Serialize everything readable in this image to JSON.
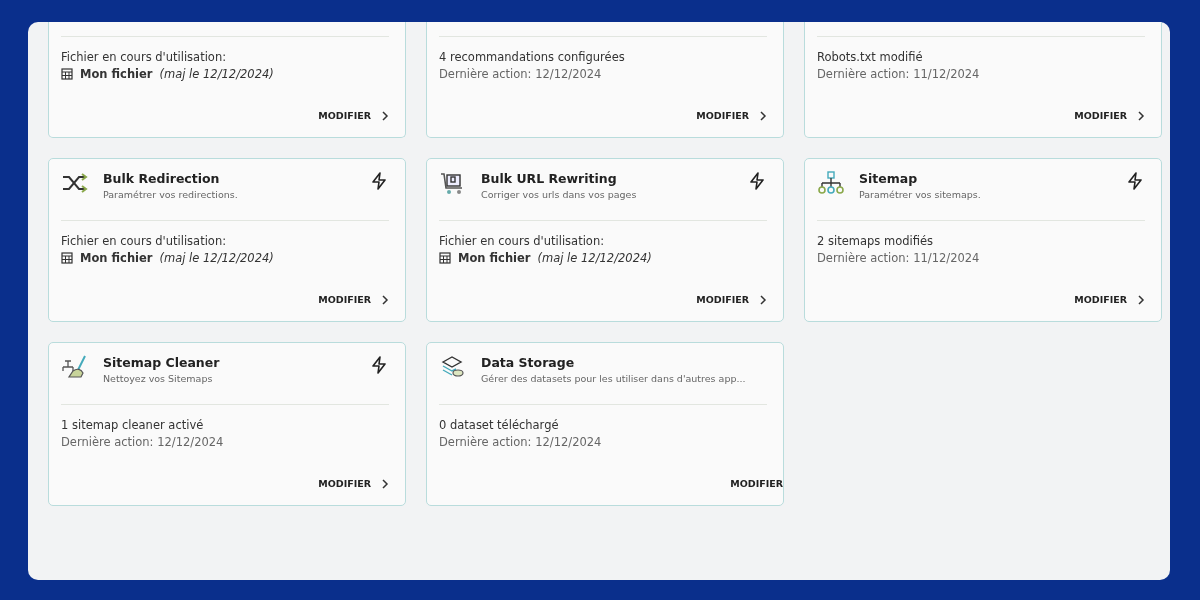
{
  "cards": [
    {
      "kind": "file",
      "label": "Fichier en cours d'utilisation:",
      "file_name": "Mon fichier",
      "file_date": "(maj le 12/12/2024)",
      "action": "MODIFIER",
      "chevron": true
    },
    {
      "kind": "stats",
      "line_1": "4 recommandations configurées",
      "line_2": "Dernière action: 12/12/2024",
      "action": "MODIFIER",
      "chevron": true
    },
    {
      "kind": "stats",
      "line_1": "Robots.txt modifié",
      "line_2": "Dernière action: 11/12/2024",
      "action": "MODIFIER",
      "chevron": true
    },
    {
      "title": "Bulk Redirection",
      "description": "Paramétrer vos redirections.",
      "bolt": true,
      "kind": "file",
      "label": "Fichier en cours d'utilisation:",
      "file_name": "Mon fichier",
      "file_date": "(maj le 12/12/2024)",
      "action": "MODIFIER",
      "chevron": true
    },
    {
      "title": "Bulk URL Rewriting",
      "description": "Corriger vos urls dans vos pages",
      "bolt": true,
      "kind": "file",
      "label": "Fichier en cours d'utilisation:",
      "file_name": "Mon fichier",
      "file_date": "(maj le 12/12/2024)",
      "action": "MODIFIER",
      "chevron": true
    },
    {
      "title": "Sitemap",
      "description": "Paramétrer vos sitemaps.",
      "bolt": true,
      "kind": "stats",
      "line_1": "2 sitemaps modifiés",
      "line_2": "Dernière action: 11/12/2024",
      "action": "MODIFIER",
      "chevron": true
    },
    {
      "title": "Sitemap Cleaner",
      "description": "Nettoyez vos Sitemaps",
      "bolt": true,
      "kind": "stats",
      "line_1": "1 sitemap cleaner activé",
      "line_2": "Dernière action: 12/12/2024",
      "action": "MODIFIER",
      "chevron": true
    },
    {
      "title": "Data Storage",
      "description": "Gérer des datasets pour les utiliser dans d'autres app...",
      "bolt": false,
      "kind": "stats",
      "line_1": "0 dataset téléchargé",
      "line_2": "Dernière action: 12/12/2024",
      "action": "MODIFIER",
      "chevron": false
    }
  ]
}
